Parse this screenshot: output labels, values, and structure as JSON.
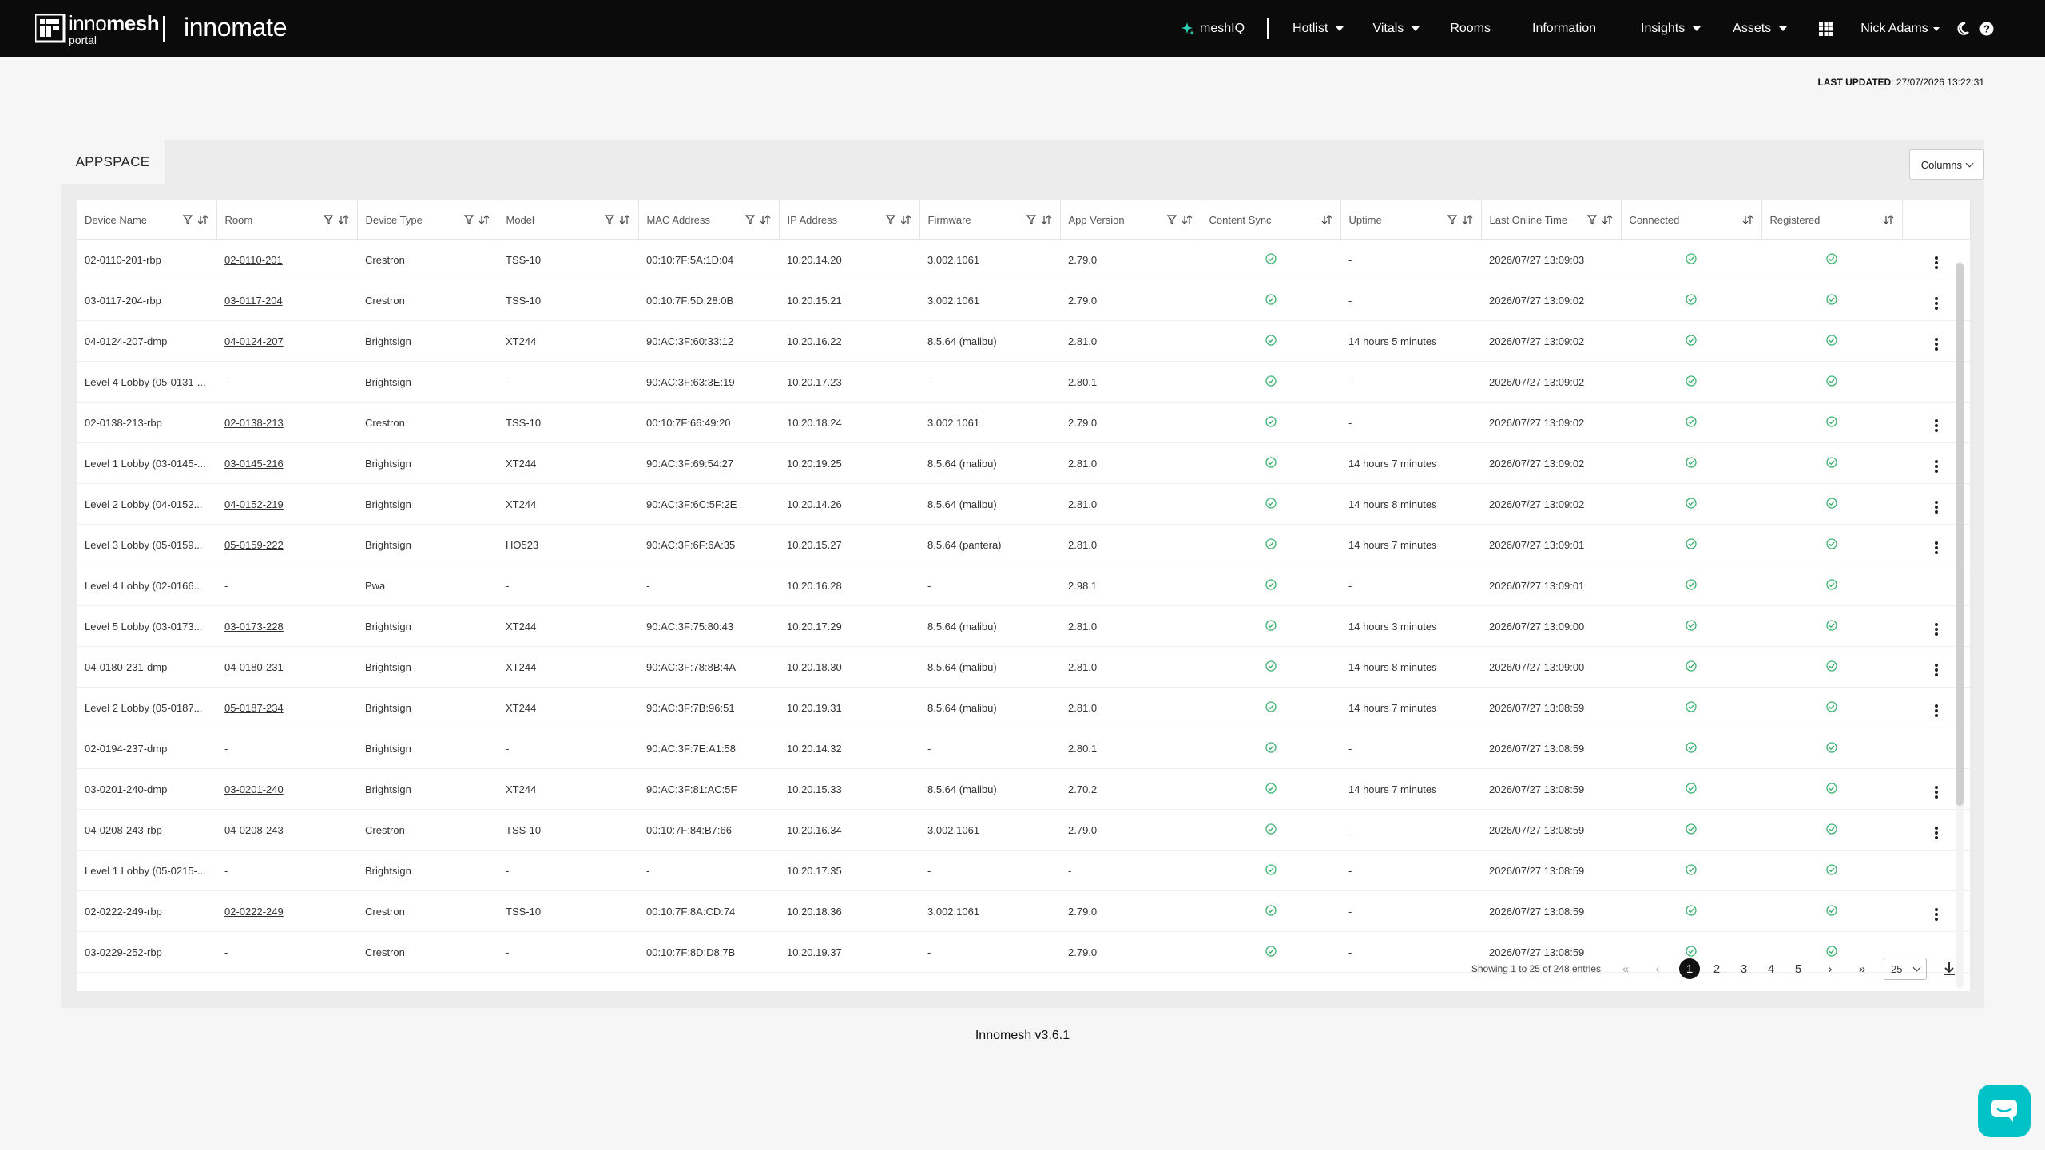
{
  "header": {
    "logo_brand_a": "inno",
    "logo_brand_b": "mesh",
    "logo_sub": "portal",
    "brand2": "innomate",
    "nav": {
      "meshiq": "meshIQ",
      "hotlist": "Hotlist",
      "vitals": "Vitals",
      "rooms": "Rooms",
      "information": "Information",
      "insights": "Insights",
      "assets": "Assets",
      "user": "Nick Adams"
    }
  },
  "last_updated": {
    "label": "LAST UPDATED",
    "value": ": 27/07/2026 13:22:31"
  },
  "panel": {
    "tab": "APPSPACE",
    "columns_button": "Columns"
  },
  "table": {
    "headers": [
      "Device Name",
      "Room",
      "Device Type",
      "Model",
      "MAC Address",
      "IP Address",
      "Firmware",
      "App Version",
      "Content Sync",
      "Uptime",
      "Last Online Time",
      "Connected",
      "Registered"
    ],
    "rows": [
      {
        "name": "02-0110-201-rbp",
        "room": "02-0110-201",
        "type": "Crestron",
        "model": "TSS-10",
        "mac": "00:10:7F:5A:1D:04",
        "ip": "10.20.14.20",
        "fw": "3.002.1061",
        "app": "2.79.0",
        "uptime": "-",
        "last": "2026/07/27 13:09:03",
        "menu": true
      },
      {
        "name": "03-0117-204-rbp",
        "room": "03-0117-204",
        "type": "Crestron",
        "model": "TSS-10",
        "mac": "00:10:7F:5D:28:0B",
        "ip": "10.20.15.21",
        "fw": "3.002.1061",
        "app": "2.79.0",
        "uptime": "-",
        "last": "2026/07/27 13:09:02",
        "menu": true
      },
      {
        "name": "04-0124-207-dmp",
        "room": "04-0124-207",
        "type": "Brightsign",
        "model": "XT244",
        "mac": "90:AC:3F:60:33:12",
        "ip": "10.20.16.22",
        "fw": "8.5.64 (malibu)",
        "app": "2.81.0",
        "uptime": "14 hours 5 minutes",
        "last": "2026/07/27 13:09:02",
        "menu": true
      },
      {
        "name": "Level 4 Lobby (05-0131-...",
        "room": "-",
        "type": "Brightsign",
        "model": "-",
        "mac": "90:AC:3F:63:3E:19",
        "ip": "10.20.17.23",
        "fw": "-",
        "app": "2.80.1",
        "uptime": "-",
        "last": "2026/07/27 13:09:02",
        "menu": false
      },
      {
        "name": "02-0138-213-rbp",
        "room": "02-0138-213",
        "type": "Crestron",
        "model": "TSS-10",
        "mac": "00:10:7F:66:49:20",
        "ip": "10.20.18.24",
        "fw": "3.002.1061",
        "app": "2.79.0",
        "uptime": "-",
        "last": "2026/07/27 13:09:02",
        "menu": true
      },
      {
        "name": "Level 1 Lobby (03-0145-...",
        "room": "03-0145-216",
        "type": "Brightsign",
        "model": "XT244",
        "mac": "90:AC:3F:69:54:27",
        "ip": "10.20.19.25",
        "fw": "8.5.64 (malibu)",
        "app": "2.81.0",
        "uptime": "14 hours 7 minutes",
        "last": "2026/07/27 13:09:02",
        "menu": true
      },
      {
        "name": "Level 2 Lobby (04-0152...",
        "room": "04-0152-219",
        "type": "Brightsign",
        "model": "XT244",
        "mac": "90:AC:3F:6C:5F:2E",
        "ip": "10.20.14.26",
        "fw": "8.5.64 (malibu)",
        "app": "2.81.0",
        "uptime": "14 hours 8 minutes",
        "last": "2026/07/27 13:09:02",
        "menu": true
      },
      {
        "name": "Level 3 Lobby (05-0159...",
        "room": "05-0159-222",
        "type": "Brightsign",
        "model": "HO523",
        "mac": "90:AC:3F:6F:6A:35",
        "ip": "10.20.15.27",
        "fw": "8.5.64 (pantera)",
        "app": "2.81.0",
        "uptime": "14 hours 7 minutes",
        "last": "2026/07/27 13:09:01",
        "menu": true
      },
      {
        "name": "Level 4 Lobby (02-0166...",
        "room": "-",
        "type": "Pwa",
        "model": "-",
        "mac": "-",
        "ip": "10.20.16.28",
        "fw": "-",
        "app": "2.98.1",
        "uptime": "-",
        "last": "2026/07/27 13:09:01",
        "menu": false
      },
      {
        "name": "Level 5 Lobby (03-0173...",
        "room": "03-0173-228",
        "type": "Brightsign",
        "model": "XT244",
        "mac": "90:AC:3F:75:80:43",
        "ip": "10.20.17.29",
        "fw": "8.5.64 (malibu)",
        "app": "2.81.0",
        "uptime": "14 hours 3 minutes",
        "last": "2026/07/27 13:09:00",
        "menu": true
      },
      {
        "name": "04-0180-231-dmp",
        "room": "04-0180-231",
        "type": "Brightsign",
        "model": "XT244",
        "mac": "90:AC:3F:78:8B:4A",
        "ip": "10.20.18.30",
        "fw": "8.5.64 (malibu)",
        "app": "2.81.0",
        "uptime": "14 hours 8 minutes",
        "last": "2026/07/27 13:09:00",
        "menu": true
      },
      {
        "name": "Level 2 Lobby (05-0187...",
        "room": "05-0187-234",
        "type": "Brightsign",
        "model": "XT244",
        "mac": "90:AC:3F:7B:96:51",
        "ip": "10.20.19.31",
        "fw": "8.5.64 (malibu)",
        "app": "2.81.0",
        "uptime": "14 hours 7 minutes",
        "last": "2026/07/27 13:08:59",
        "menu": true
      },
      {
        "name": "02-0194-237-dmp",
        "room": "-",
        "type": "Brightsign",
        "model": "-",
        "mac": "90:AC:3F:7E:A1:58",
        "ip": "10.20.14.32",
        "fw": "-",
        "app": "2.80.1",
        "uptime": "-",
        "last": "2026/07/27 13:08:59",
        "menu": false
      },
      {
        "name": "03-0201-240-dmp",
        "room": "03-0201-240",
        "type": "Brightsign",
        "model": "XT244",
        "mac": "90:AC:3F:81:AC:5F",
        "ip": "10.20.15.33",
        "fw": "8.5.64 (malibu)",
        "app": "2.70.2",
        "uptime": "14 hours 7 minutes",
        "last": "2026/07/27 13:08:59",
        "menu": true
      },
      {
        "name": "04-0208-243-rbp",
        "room": "04-0208-243",
        "type": "Crestron",
        "model": "TSS-10",
        "mac": "00:10:7F:84:B7:66",
        "ip": "10.20.16.34",
        "fw": "3.002.1061",
        "app": "2.79.0",
        "uptime": "-",
        "last": "2026/07/27 13:08:59",
        "menu": true
      },
      {
        "name": "Level 1 Lobby (05-0215-...",
        "room": "-",
        "type": "Brightsign",
        "model": "-",
        "mac": "-",
        "ip": "10.20.17.35",
        "fw": "-",
        "app": "-",
        "uptime": "-",
        "last": "2026/07/27 13:08:59",
        "menu": false
      },
      {
        "name": "02-0222-249-rbp",
        "room": "02-0222-249",
        "type": "Crestron",
        "model": "TSS-10",
        "mac": "00:10:7F:8A:CD:74",
        "ip": "10.20.18.36",
        "fw": "3.002.1061",
        "app": "2.79.0",
        "uptime": "-",
        "last": "2026/07/27 13:08:59",
        "menu": true
      },
      {
        "name": "03-0229-252-rbp",
        "room": "-",
        "type": "Crestron",
        "model": "-",
        "mac": "00:10:7F:8D:D8:7B",
        "ip": "10.20.19.37",
        "fw": "-",
        "app": "2.79.0",
        "uptime": "-",
        "last": "2026/07/27 13:08:59",
        "menu": false
      }
    ]
  },
  "pagination": {
    "info": "Showing 1 to 25 of 248 entries",
    "pages": [
      "1",
      "2",
      "3",
      "4",
      "5"
    ],
    "active_page": "1",
    "per_page": "25"
  },
  "footer": {
    "version": "Innomesh v3.6.1"
  },
  "colors": {
    "accent": "#00c2c7",
    "check": "#3cb371",
    "topbar": "#0b0b0b"
  }
}
